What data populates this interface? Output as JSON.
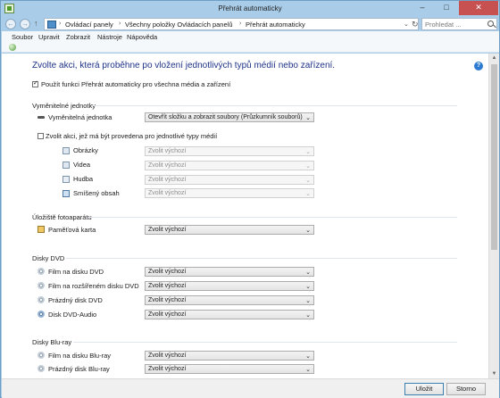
{
  "window": {
    "title": "Přehrát automaticky",
    "minimize": "–",
    "maximize": "□",
    "close": "✕"
  },
  "address": {
    "crumbs": [
      "Ovládací panely",
      "Všechny položky Ovládacích panelů",
      "Přehrát automaticky"
    ],
    "separator": "›",
    "search_placeholder": "Prohledat ..."
  },
  "menu": [
    "Soubor",
    "Upravit",
    "Zobrazit",
    "Nástroje",
    "Nápověda"
  ],
  "heading": "Zvolte akci, která proběhne po vložení jednotlivých typů médií nebo zařízení.",
  "use_autoplay": {
    "label": "Použít funkci Přehrát automaticky pro všechna média a zařízení",
    "checked": true
  },
  "sections": {
    "removable": {
      "title": "Vyměnitelné jednotky",
      "drive": {
        "label": "Vyměnitelná jednotka",
        "value": "Otevřít složku a zobrazit soubory (Průzkumník souborů)"
      },
      "per_type": {
        "label": "Zvolit akci, jež má být provedena pro jednotlivé typy médií",
        "checked": false
      },
      "types": [
        {
          "label": "Obrázky",
          "value": "Zvolit výchozí"
        },
        {
          "label": "Videa",
          "value": "Zvolit výchozí"
        },
        {
          "label": "Hudba",
          "value": "Zvolit výchozí"
        },
        {
          "label": "Smíšený obsah",
          "value": "Zvolit výchozí"
        }
      ]
    },
    "camera_storage": {
      "title": "Úložiště fotoaparátu",
      "items": [
        {
          "label": "Paměťová karta",
          "value": "Zvolit výchozí"
        }
      ]
    },
    "dvd": {
      "title": "Disky DVD",
      "items": [
        {
          "label": "Film na disku DVD",
          "value": "Zvolit výchozí"
        },
        {
          "label": "Film na rozšířeném disku DVD",
          "value": "Zvolit výchozí"
        },
        {
          "label": "Prázdný disk DVD",
          "value": "Zvolit výchozí"
        },
        {
          "label": "Disk DVD-Audio",
          "value": "Zvolit výchozí"
        }
      ]
    },
    "bluray": {
      "title": "Disky Blu-ray",
      "items": [
        {
          "label": "Film na disku Blu-ray",
          "value": "Zvolit výchozí"
        },
        {
          "label": "Prázdný disk Blu-ray",
          "value": "Zvolit výchozí"
        }
      ]
    }
  },
  "footer": {
    "save": "Uložit",
    "cancel": "Storno"
  }
}
